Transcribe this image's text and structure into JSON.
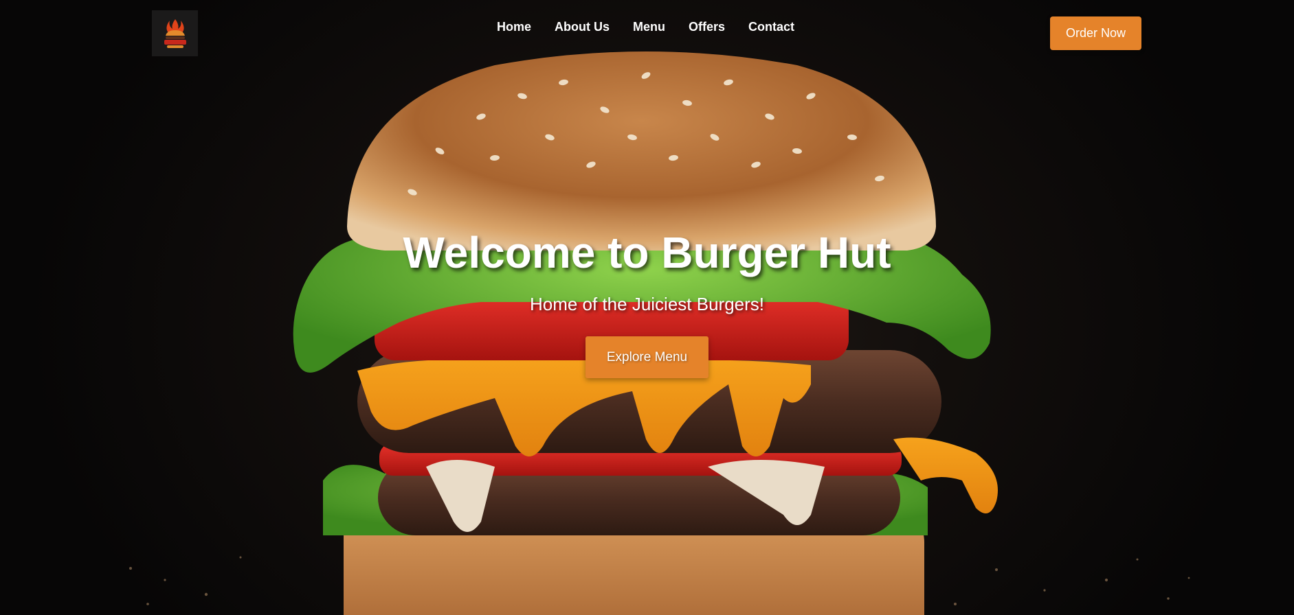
{
  "nav": {
    "logo_alt": "Burger Hut logo",
    "links": [
      "Home",
      "About Us",
      "Menu",
      "Offers",
      "Contact"
    ],
    "order_label": "Order Now"
  },
  "hero": {
    "title": "Welcome to Burger Hut",
    "subtitle": "Home of the Juiciest Burgers!",
    "cta_label": "Explore Menu"
  },
  "icons": {
    "logo": "burger-flame-logo-icon"
  },
  "colors": {
    "accent": "#e5832a",
    "background": "#0b0908",
    "text": "#ffffff"
  }
}
